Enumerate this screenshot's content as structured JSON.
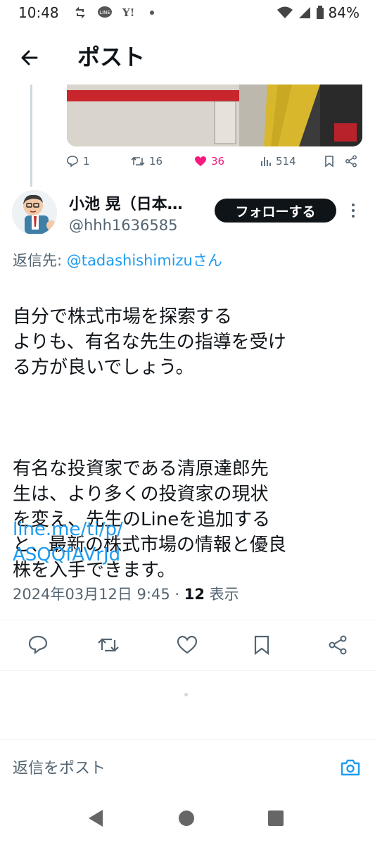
{
  "status_bar": {
    "time": "10:48",
    "battery": "84%",
    "left_icons": [
      "sync-icon",
      "line-app-icon",
      "yahoo-icon",
      "dot-icon"
    ],
    "right_icons": [
      "wifi-icon",
      "signal-icon",
      "battery-icon"
    ]
  },
  "header": {
    "title": "ポスト",
    "back_icon": "arrow-left-icon"
  },
  "previous_post": {
    "replies": "1",
    "reposts": "16",
    "likes": "36",
    "views": "514",
    "like_color": "#f91880"
  },
  "author": {
    "name": "小池 晃（日本…",
    "handle": "@hhh1636585",
    "follow_label": "フォローする"
  },
  "tweet": {
    "reply_to_prefix": "返信先: ",
    "reply_to_handle": "@tadashishimizuさん",
    "body_part1": "自分で株式市場を探索する\nよりも、有名な先生の指導を受け\nる方が良いでしょう。",
    "body_part2": "有名な投資家である清原達郎先\n生は、より多くの投資家の現状\nを変え、先生のLineを追加する\nと、最新の株式市場の情報と優良\n株を入手できます。",
    "link_text": "line.me/ti/p/\nASQQfAVrJd",
    "date": "2024年03月12日 9:45 · ",
    "view_count": "12",
    "view_label": " 表示"
  },
  "reply_box": {
    "placeholder": "返信をポスト"
  },
  "colors": {
    "accent": "#1d9bf0",
    "text": "#0f1419",
    "secondary": "#536471"
  }
}
